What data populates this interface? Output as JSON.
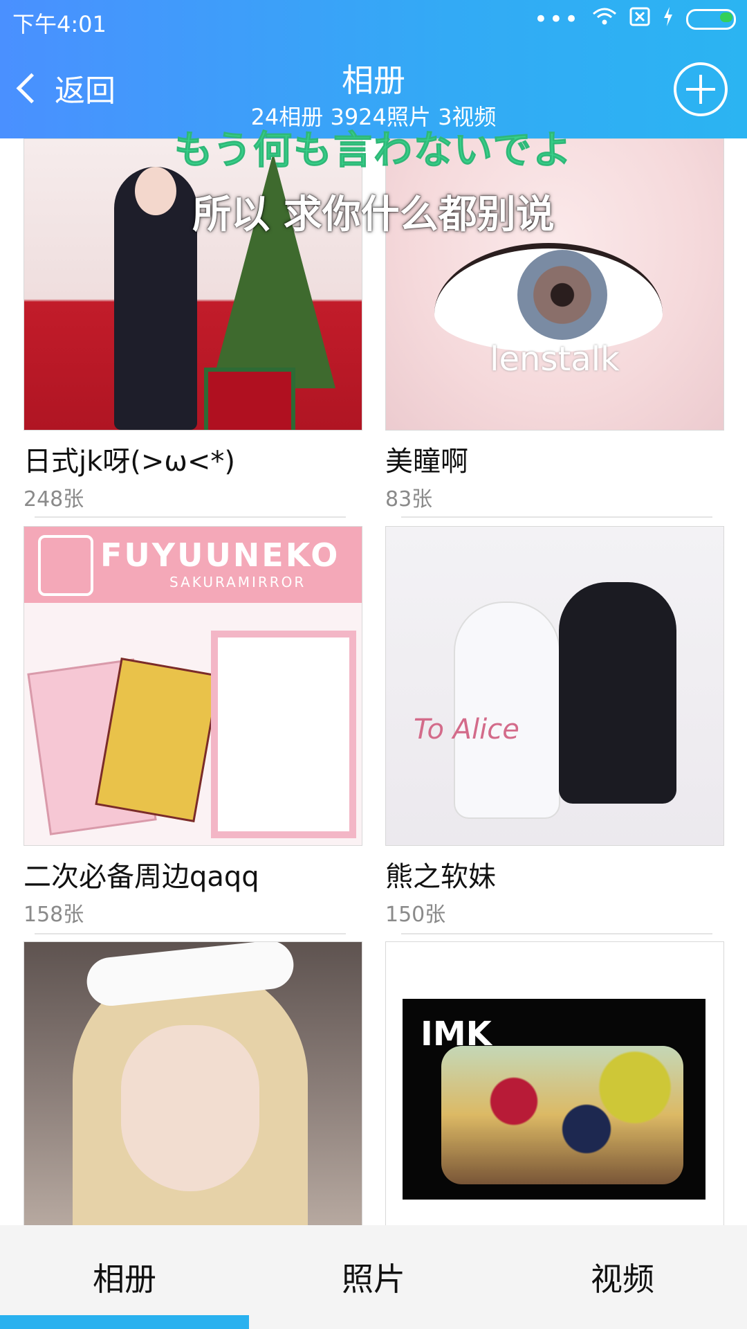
{
  "status_bar": {
    "time": "下午4:01"
  },
  "header": {
    "back_label": "返回",
    "title": "相册",
    "subtitle": "24相册  3924照片  3视频"
  },
  "overlay": {
    "lyric_jp": "もう何も言わないでよ",
    "lyric_cn": "所以 求你什么都别说"
  },
  "albums": [
    {
      "title": "日式jk呀(>ω<*)",
      "count": "248张"
    },
    {
      "title": "美瞳啊",
      "count": "83张",
      "thumb_text": "lenstalk"
    },
    {
      "title": "二次必备周边qaqq",
      "count": "158张",
      "thumb_text": "FUYUUNEKO",
      "thumb_sub": "SAKURAMIRROR"
    },
    {
      "title": "熊之软妹",
      "count": "150张",
      "thumb_text": "To Alice"
    },
    {
      "title": "",
      "count": ""
    },
    {
      "title": "",
      "count": "",
      "thumb_text": "IMK"
    }
  ],
  "tabs": [
    {
      "label": "相册"
    },
    {
      "label": "照片"
    },
    {
      "label": "视频"
    }
  ],
  "colors": {
    "accent": "#29b1ef",
    "header_start": "#4a90ff",
    "header_end": "#2bb4f2",
    "lyric_jp": "#38d18a"
  }
}
